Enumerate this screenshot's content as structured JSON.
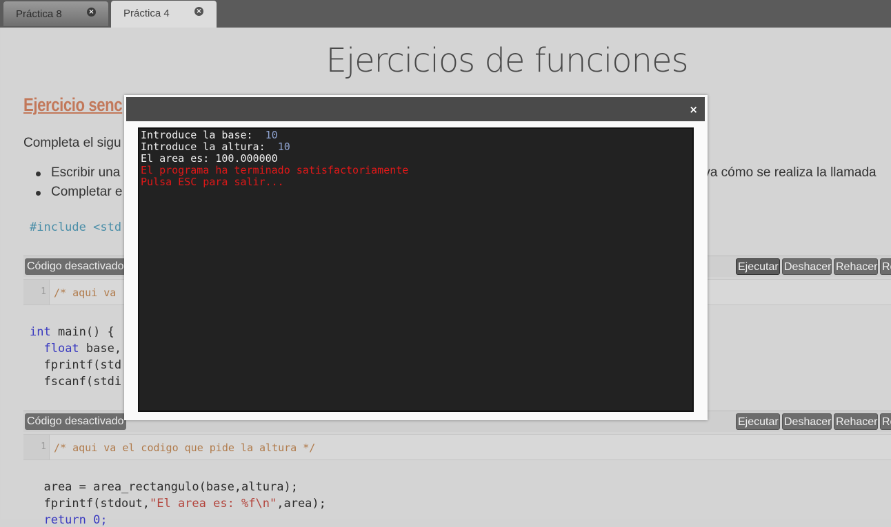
{
  "tabs": [
    {
      "label": "Práctica 8",
      "active": false
    },
    {
      "label": "Práctica 4",
      "active": true
    }
  ],
  "page": {
    "title": "Ejercicios de funciones",
    "exercise_title": "Ejercicio senc",
    "intro": "Completa el sigu",
    "bullets": [
      {
        "start": "Escribir una",
        "tail": "rva cómo se realiza la llamada"
      },
      {
        "start": "Completar e"
      }
    ],
    "code_include": "#include <std",
    "code_main": [
      "int main() {",
      "  float base,",
      "  fprintf(std",
      "  fscanf(stdi"
    ],
    "code_bottom": {
      "line1": "  area = area_rectangulo(base,altura);",
      "line2_pre": "  fprintf(stdout,",
      "line2_str": "\"El area es: %f\\n\"",
      "line2_post": ",area);",
      "line3": "  return 0;"
    }
  },
  "editors": [
    {
      "disabled_label": "Código desactivado",
      "line_number": "1",
      "code": "/* aqui va "
    },
    {
      "disabled_label": "Código desactivado",
      "line_number": "1",
      "code": "/* aqui va el codigo que pide la altura */"
    }
  ],
  "buttons": {
    "run": "Ejecutar",
    "undo": "Deshacer",
    "redo": "Rehacer",
    "more": "Re"
  },
  "terminal": {
    "close": "×",
    "lines": [
      {
        "prompt": "Introduce la base:  ",
        "input": "10"
      },
      {
        "prompt": "Introduce la altura:  ",
        "input": "10"
      },
      {
        "prompt": "El area es: 100.000000"
      },
      {
        "error": "El programa ha terminado satisfactoriamente"
      },
      {
        "error": "Pulsa ESC para salir..."
      }
    ]
  },
  "colors": {
    "exercise_title": "#c2785a",
    "terminal_bg": "#222222",
    "terminal_error": "#e01818",
    "terminal_input": "#8fa3d0"
  }
}
